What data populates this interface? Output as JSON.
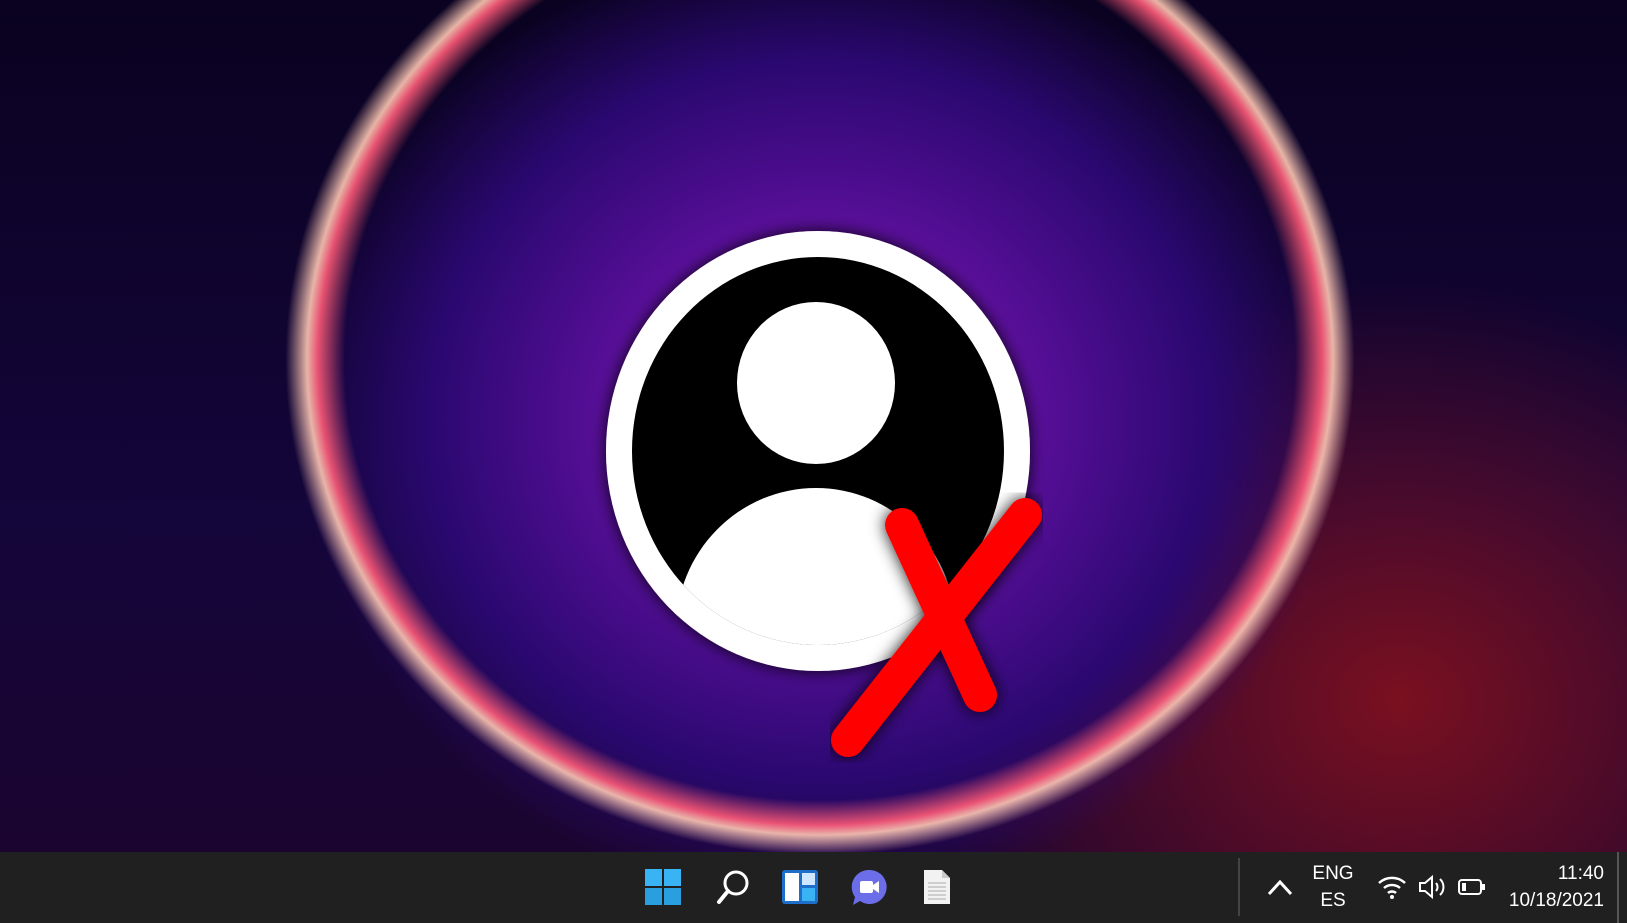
{
  "taskbar": {
    "icons": [
      "start-icon",
      "search-icon",
      "widgets-icon",
      "chat-icon",
      "notepad-icon"
    ],
    "tray": {
      "language_primary": "ENG",
      "language_secondary": "ES",
      "time": "11:40",
      "date": "10/18/2021"
    }
  },
  "colors": {
    "accent": "#3ab3f5",
    "x_mark": "#ff0000",
    "chat": "#6b6ee8"
  }
}
